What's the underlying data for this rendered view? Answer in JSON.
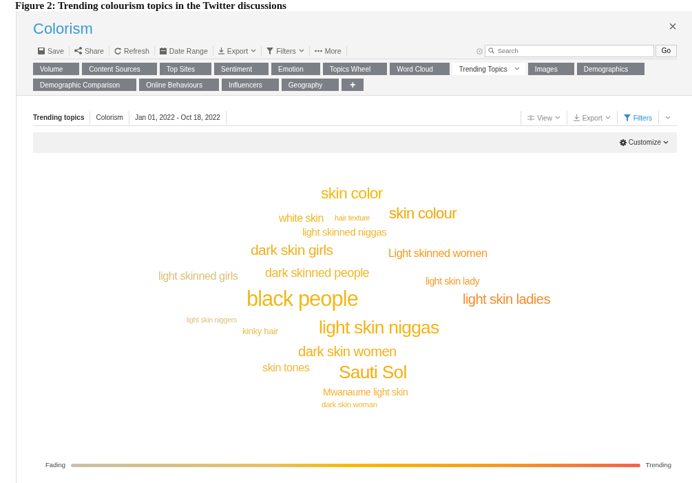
{
  "caption": "Figure 2: Trending colourism topics in the Twitter discussions",
  "header": {
    "title": "Colorism",
    "close": "×"
  },
  "toolbar": [
    {
      "kind": "save",
      "label": "Save",
      "dropdown": false
    },
    {
      "kind": "share",
      "label": "Share",
      "dropdown": false
    },
    {
      "kind": "refresh",
      "label": "Refresh",
      "dropdown": false
    },
    {
      "kind": "calendar",
      "label": "Date Range",
      "dropdown": false
    },
    {
      "kind": "export",
      "label": "Export",
      "dropdown": true
    },
    {
      "kind": "filter",
      "label": "Filters",
      "dropdown": true
    },
    {
      "kind": "more",
      "label": "More",
      "dropdown": false
    }
  ],
  "search": {
    "placeholder": "Search",
    "button": "Go"
  },
  "tabs": [
    {
      "label": "Volume",
      "selected": false,
      "dropdown": false
    },
    {
      "label": "Content Sources",
      "selected": false,
      "dropdown": false
    },
    {
      "label": "Top Sites",
      "selected": false,
      "dropdown": false
    },
    {
      "label": "Sentiment",
      "selected": false,
      "dropdown": false
    },
    {
      "label": "Emotion",
      "selected": false,
      "dropdown": false
    },
    {
      "label": "Topics Wheel",
      "selected": false,
      "dropdown": false
    },
    {
      "label": "Word Cloud",
      "selected": false,
      "dropdown": false
    },
    {
      "label": "Trending Topics",
      "selected": true,
      "dropdown": true
    },
    {
      "label": "Images",
      "selected": false,
      "dropdown": false
    },
    {
      "label": "Demographics",
      "selected": false,
      "dropdown": false
    }
  ],
  "tabs_row_2": [
    {
      "label": "Demographic Comparison",
      "selected": false,
      "kind": "tab"
    },
    {
      "label": "Online Behaviours",
      "selected": false,
      "kind": "tab"
    },
    {
      "label": "Influencers",
      "selected": false,
      "kind": "tab"
    },
    {
      "label": "Geography",
      "selected": false,
      "kind": "tab"
    },
    {
      "label": "+",
      "selected": false,
      "kind": "add"
    }
  ],
  "breadcrumbs": [
    {
      "label": "Trending topics",
      "bold": true
    },
    {
      "label": "Colorism",
      "bold": false
    },
    {
      "label": "Jan 01, 2022 - Oct 18, 2022",
      "bold": false
    }
  ],
  "view_actions": [
    {
      "kind": "view",
      "label": "View",
      "active": false
    },
    {
      "kind": "export",
      "label": "Export",
      "active": false
    },
    {
      "kind": "filter",
      "label": "Filters",
      "active": true
    },
    {
      "kind": "collapse",
      "active": false
    }
  ],
  "customize": "Customize",
  "word_cloud": {
    "words": [
      {
        "text": "skin color",
        "color": "#f5b70a"
      },
      {
        "text": "white skin",
        "color": "#f0b820"
      },
      {
        "text": "hair texture",
        "color": "#f0b020"
      },
      {
        "text": "skin colour",
        "color": "#f5a800"
      },
      {
        "text": "light skinned niggas",
        "color": "#f0b830"
      },
      {
        "text": "dark skin girls",
        "color": "#f0b020"
      },
      {
        "text": "Light skinned women",
        "color": "#f79a20"
      },
      {
        "text": "light skinned girls",
        "color": "#d9c07a"
      },
      {
        "text": "dark skinned people",
        "color": "#f0b828"
      },
      {
        "text": "light skin lady",
        "color": "#f79b2a"
      },
      {
        "text": "black people",
        "color": "#f0b81a"
      },
      {
        "text": "light skin ladies",
        "color": "#f58b2a"
      },
      {
        "text": "light skin niggers",
        "color": "#dcc080"
      },
      {
        "text": "kinky hair",
        "color": "#e8be50"
      },
      {
        "text": "light skin niggas",
        "color": "#f5b415"
      },
      {
        "text": "dark skin women",
        "color": "#f5b015"
      },
      {
        "text": "skin tones",
        "color": "#f0b83a"
      },
      {
        "text": "Sauti Sol",
        "color": "#f5ad10"
      },
      {
        "text": "Mwanaume light skin",
        "color": "#f5b030"
      },
      {
        "text": "dark skin woman",
        "color": "#f0b830"
      }
    ]
  },
  "legend": {
    "start": "Fading",
    "end": "Trending"
  }
}
